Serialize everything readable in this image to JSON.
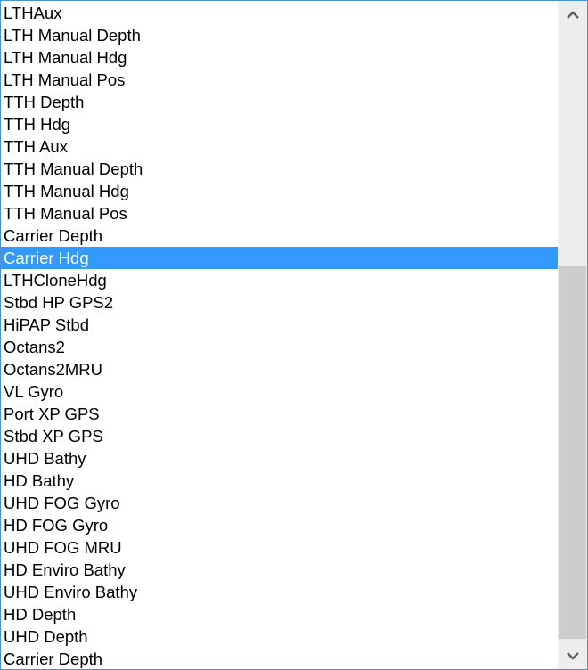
{
  "listbox": {
    "selected_index": 11,
    "items": [
      "LTHAux",
      "LTH Manual Depth",
      "LTH Manual Hdg",
      "LTH Manual Pos",
      "TTH Depth",
      "TTH Hdg",
      "TTH Aux",
      "TTH Manual Depth",
      "TTH Manual Hdg",
      "TTH Manual Pos",
      "Carrier Depth",
      "Carrier Hdg",
      "LTHCloneHdg",
      "Stbd HP GPS2",
      "HiPAP Stbd",
      "Octans2",
      "Octans2MRU",
      "VL Gyro",
      "Port XP GPS",
      "Stbd XP GPS",
      "UHD Bathy",
      "HD Bathy",
      "UHD FOG Gyro",
      "HD FOG Gyro",
      "UHD FOG MRU",
      "HD Enviro Bathy",
      "UHD Enviro Bathy",
      "HD Depth",
      "UHD Depth",
      "Carrier Depth"
    ]
  },
  "colors": {
    "selection": "#3399ff",
    "border": "#4a90d9",
    "scrollbar_track": "#ededed",
    "scrollbar_thumb": "#cdcdcd"
  }
}
